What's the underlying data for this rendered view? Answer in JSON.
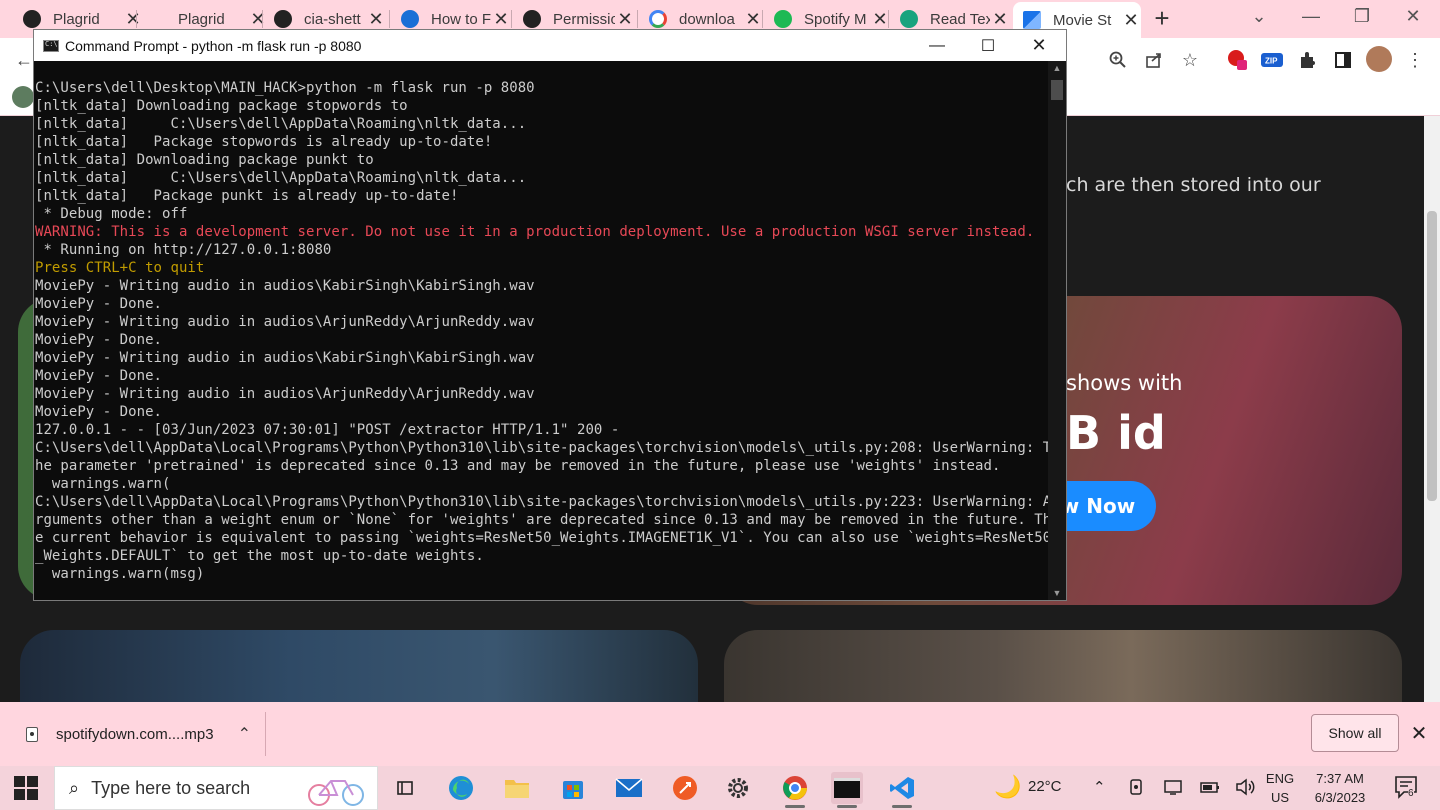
{
  "browser": {
    "tabs": [
      {
        "title": "Plagrid",
        "icon": "gear-icon"
      },
      {
        "title": "Plagrid",
        "icon": "blank-icon"
      },
      {
        "title": "cia-shett",
        "icon": "github-icon"
      },
      {
        "title": "How to F",
        "icon": "swirl-icon"
      },
      {
        "title": "Permissio",
        "icon": "github-icon"
      },
      {
        "title": "downloa",
        "icon": "google-icon"
      },
      {
        "title": "Spotify M",
        "icon": "spotify-icon"
      },
      {
        "title": "Read Tex",
        "icon": "chatgpt-icon"
      },
      {
        "title": "Movie St",
        "icon": "movie-icon",
        "active": true
      }
    ],
    "new_tab_symbol": "+",
    "accent_color": "#ffd6df"
  },
  "webpage": {
    "headline_fragment": "ch are then stored into our",
    "hero_sub_fragment": "shows with",
    "hero_big_fragment": "B id",
    "hero_button_fragment": "w Now",
    "button_color": "#1a8cff"
  },
  "cmd": {
    "title": "Command Prompt - python  -m flask run -p 8080",
    "lines": [
      {
        "t": "C:\\Users\\dell\\Desktop\\MAIN_HACK>python -m flask run -p 8080",
        "c": ""
      },
      {
        "t": "[nltk_data] Downloading package stopwords to",
        "c": ""
      },
      {
        "t": "[nltk_data]     C:\\Users\\dell\\AppData\\Roaming\\nltk_data...",
        "c": ""
      },
      {
        "t": "[nltk_data]   Package stopwords is already up-to-date!",
        "c": ""
      },
      {
        "t": "[nltk_data] Downloading package punkt to",
        "c": ""
      },
      {
        "t": "[nltk_data]     C:\\Users\\dell\\AppData\\Roaming\\nltk_data...",
        "c": ""
      },
      {
        "t": "[nltk_data]   Package punkt is already up-to-date!",
        "c": ""
      },
      {
        "t": " * Debug mode: off",
        "c": ""
      },
      {
        "t": "WARNING: This is a development server. Do not use it in a production deployment. Use a production WSGI server instead.",
        "c": "red"
      },
      {
        "t": " * Running on http://127.0.0.1:8080",
        "c": ""
      },
      {
        "t": "Press CTRL+C to quit",
        "c": "yel"
      },
      {
        "t": "MoviePy - Writing audio in audios\\KabirSingh\\KabirSingh.wav",
        "c": ""
      },
      {
        "t": "MoviePy - Done.",
        "c": ""
      },
      {
        "t": "MoviePy - Writing audio in audios\\ArjunReddy\\ArjunReddy.wav",
        "c": ""
      },
      {
        "t": "MoviePy - Done.",
        "c": ""
      },
      {
        "t": "MoviePy - Writing audio in audios\\KabirSingh\\KabirSingh.wav",
        "c": ""
      },
      {
        "t": "MoviePy - Done.",
        "c": ""
      },
      {
        "t": "MoviePy - Writing audio in audios\\ArjunReddy\\ArjunReddy.wav",
        "c": ""
      },
      {
        "t": "MoviePy - Done.",
        "c": ""
      },
      {
        "t": "127.0.0.1 - - [03/Jun/2023 07:30:01] \"POST /extractor HTTP/1.1\" 200 -",
        "c": ""
      },
      {
        "t": "C:\\Users\\dell\\AppData\\Local\\Programs\\Python\\Python310\\lib\\site-packages\\torchvision\\models\\_utils.py:208: UserWarning: T",
        "c": ""
      },
      {
        "t": "he parameter 'pretrained' is deprecated since 0.13 and may be removed in the future, please use 'weights' instead.",
        "c": ""
      },
      {
        "t": "  warnings.warn(",
        "c": ""
      },
      {
        "t": "C:\\Users\\dell\\AppData\\Local\\Programs\\Python\\Python310\\lib\\site-packages\\torchvision\\models\\_utils.py:223: UserWarning: A",
        "c": ""
      },
      {
        "t": "rguments other than a weight enum or `None` for 'weights' are deprecated since 0.13 and may be removed in the future. Th",
        "c": ""
      },
      {
        "t": "e current behavior is equivalent to passing `weights=ResNet50_Weights.IMAGENET1K_V1`. You can also use `weights=ResNet50",
        "c": ""
      },
      {
        "t": "_Weights.DEFAULT` to get the most up-to-date weights.",
        "c": ""
      },
      {
        "t": "  warnings.warn(msg)",
        "c": ""
      }
    ]
  },
  "downloads": {
    "file_name": "spotifydown.com....mp3",
    "show_all": "Show all"
  },
  "taskbar": {
    "search_placeholder": "Type here to search",
    "weather": "22°C",
    "lang_1": "ENG",
    "lang_2": "US",
    "time": "7:37 AM",
    "date": "6/3/2023",
    "notif_count": "6"
  }
}
